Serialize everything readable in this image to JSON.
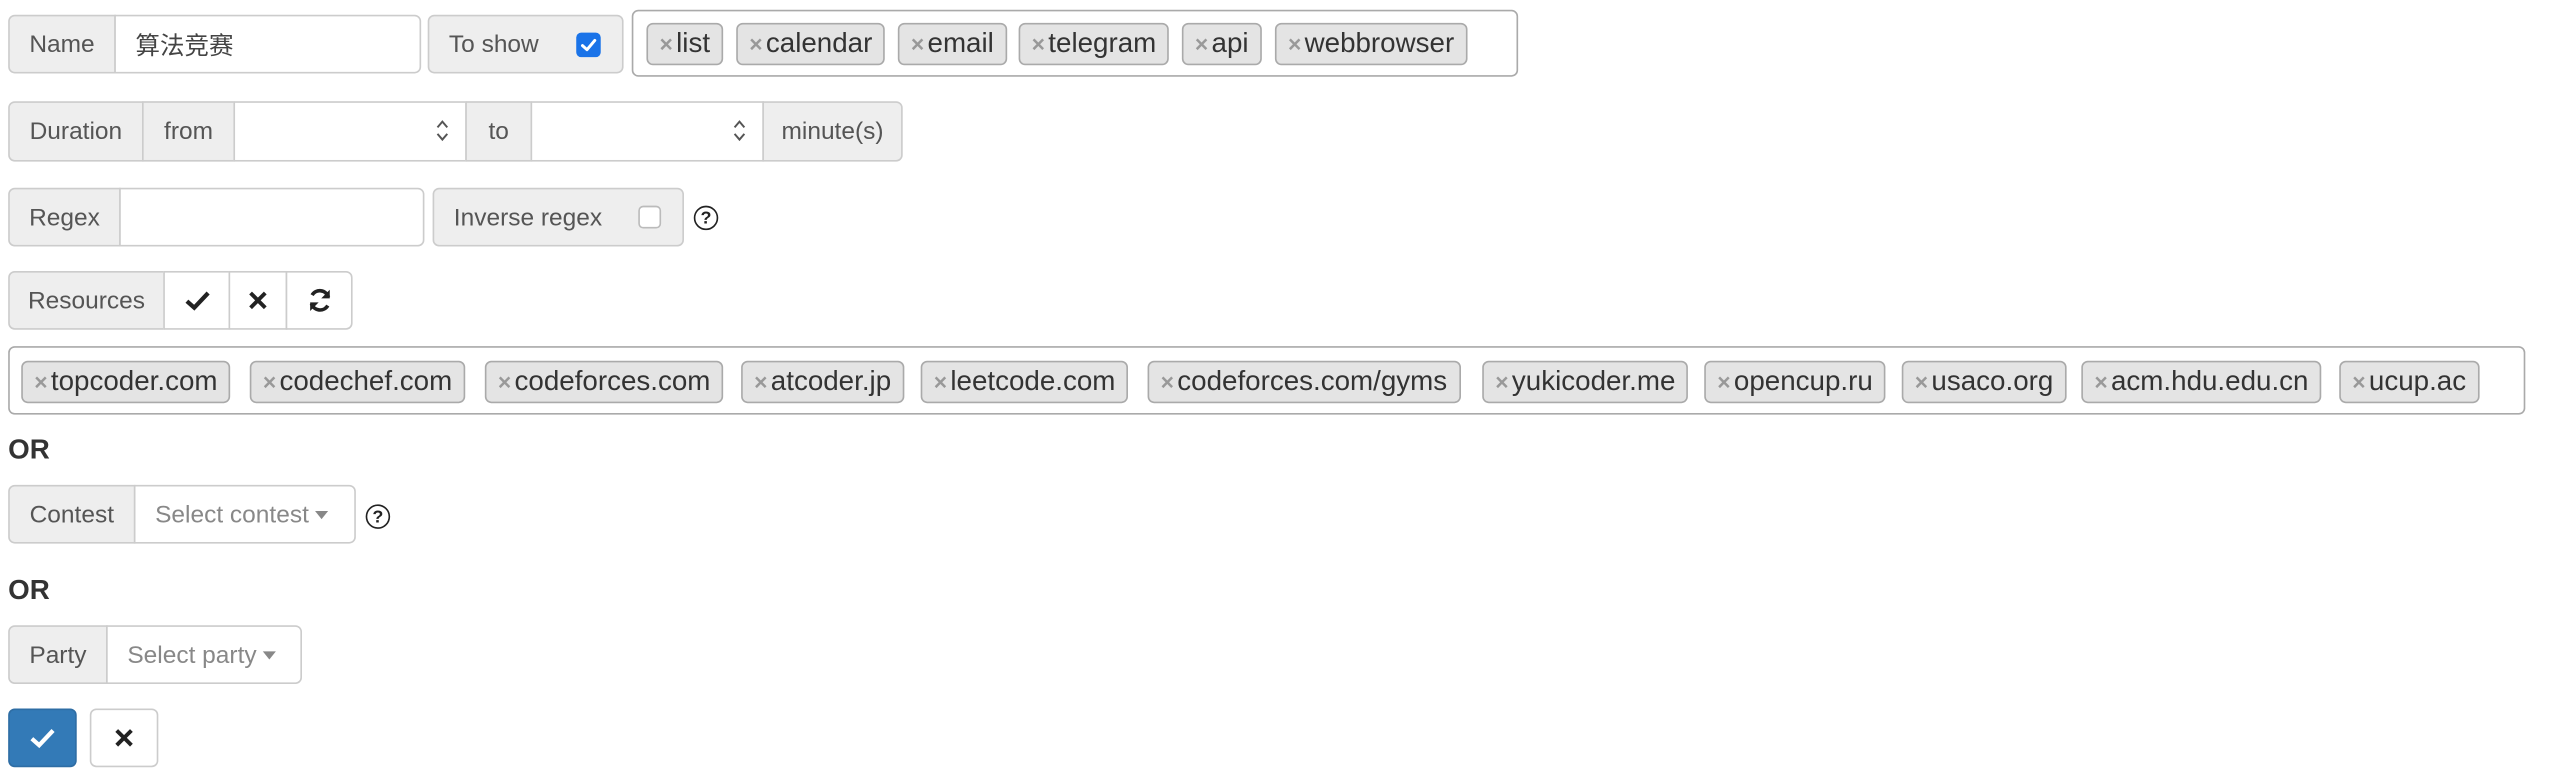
{
  "filters": {
    "name": {
      "label": "Name",
      "value": "算法竞赛"
    },
    "to_show": {
      "label": "To show",
      "checked": true,
      "tags": [
        "list",
        "calendar",
        "email",
        "telegram",
        "api",
        "webbrowser"
      ]
    },
    "duration": {
      "label": "Duration",
      "from_label": "from",
      "from_value": "",
      "to_label": "to",
      "to_value": "",
      "unit": "minute(s)"
    },
    "regex": {
      "label": "Regex",
      "value": "",
      "inverse_label": "Inverse regex",
      "inverse_checked": false,
      "help": "?"
    },
    "resources": {
      "label": "Resources",
      "select_all_icon": "check-icon",
      "clear_icon": "times-icon",
      "refresh_icon": "refresh-icon",
      "tags": [
        "topcoder.com",
        "codechef.com",
        "codeforces.com",
        "atcoder.jp",
        "leetcode.com",
        "codeforces.com/gyms",
        "yukicoder.me",
        "opencup.ru",
        "usaco.org",
        "acm.hdu.edu.cn",
        "ucup.ac"
      ]
    },
    "or_1": "OR",
    "contest": {
      "label": "Contest",
      "placeholder": "Select contest",
      "help": "?"
    },
    "or_2": "OR",
    "party": {
      "label": "Party",
      "placeholder": "Select party"
    }
  },
  "actions": {
    "submit_icon": "check-icon",
    "cancel_icon": "times-icon",
    "submit_color": "#337ab7"
  },
  "remove_glyph": "×"
}
